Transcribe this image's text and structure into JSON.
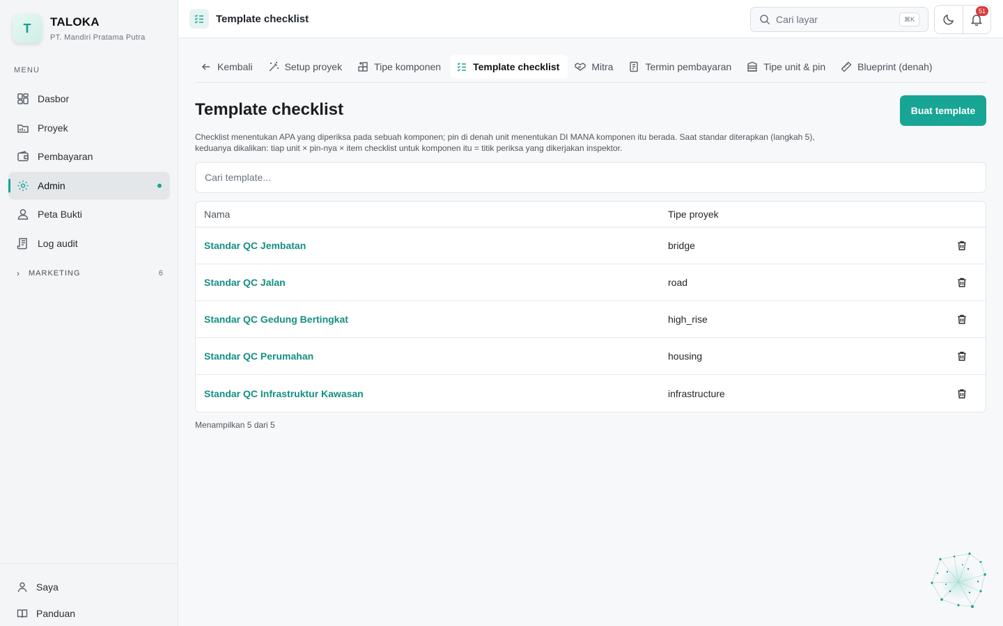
{
  "brand": {
    "logo_letter": "T",
    "name": "TALOKA",
    "org": "PT. Mandiri Pratama Putra"
  },
  "sidebar": {
    "menu_caption": "MENU",
    "items": [
      {
        "label": "Dasbor",
        "icon": "dashboard-icon"
      },
      {
        "label": "Proyek",
        "icon": "folder-icon"
      },
      {
        "label": "Pembayaran",
        "icon": "wallet-icon"
      },
      {
        "label": "Admin",
        "icon": "gear-icon",
        "active": true
      },
      {
        "label": "Peta Bukti",
        "icon": "user-pin-icon"
      },
      {
        "label": "Log audit",
        "icon": "scroll-icon"
      }
    ],
    "group": {
      "label": "MARKETING",
      "count": "6"
    },
    "bottom": [
      {
        "label": "Saya",
        "icon": "user-icon"
      },
      {
        "label": "Panduan",
        "icon": "book-icon"
      }
    ]
  },
  "header": {
    "title": "Template checklist",
    "search_placeholder": "Cari layar",
    "search_shortcut": "⌘K",
    "notification_count": "51"
  },
  "tabs": [
    {
      "label": "Kembali",
      "icon": "arrow-left-icon"
    },
    {
      "label": "Setup proyek",
      "icon": "wand-icon"
    },
    {
      "label": "Tipe komponen",
      "icon": "components-icon"
    },
    {
      "label": "Template checklist",
      "icon": "checklist-icon",
      "active": true
    },
    {
      "label": "Mitra",
      "icon": "handshake-icon"
    },
    {
      "label": "Termin pembayaran",
      "icon": "receipt-icon"
    },
    {
      "label": "Tipe unit & pin",
      "icon": "building-icon"
    },
    {
      "label": "Blueprint (denah)",
      "icon": "ruler-icon"
    }
  ],
  "page": {
    "title": "Template checklist",
    "create_button": "Buat template",
    "description": "Checklist menentukan APA yang diperiksa pada sebuah komponen; pin di denah unit menentukan DI MANA komponen itu berada. Saat standar diterapkan (langkah 5), keduanya dikalikan: tiap unit × pin-nya × item checklist untuk komponen itu = titik periksa yang dikerjakan inspektor.",
    "filter_placeholder": "Cari template...",
    "table": {
      "columns": [
        "Nama",
        "Tipe proyek"
      ],
      "rows": [
        {
          "name": "Standar QC Jembatan",
          "type": "bridge"
        },
        {
          "name": "Standar QC Jalan",
          "type": "road"
        },
        {
          "name": "Standar QC Gedung Bertingkat",
          "type": "high_rise"
        },
        {
          "name": "Standar QC Perumahan",
          "type": "housing"
        },
        {
          "name": "Standar QC Infrastruktur Kawasan",
          "type": "infrastructure"
        }
      ]
    },
    "footnote": "Menampilkan 5 dari 5"
  },
  "colors": {
    "accent": "#18a595",
    "link": "#128f80",
    "badge": "#d83a3a"
  }
}
